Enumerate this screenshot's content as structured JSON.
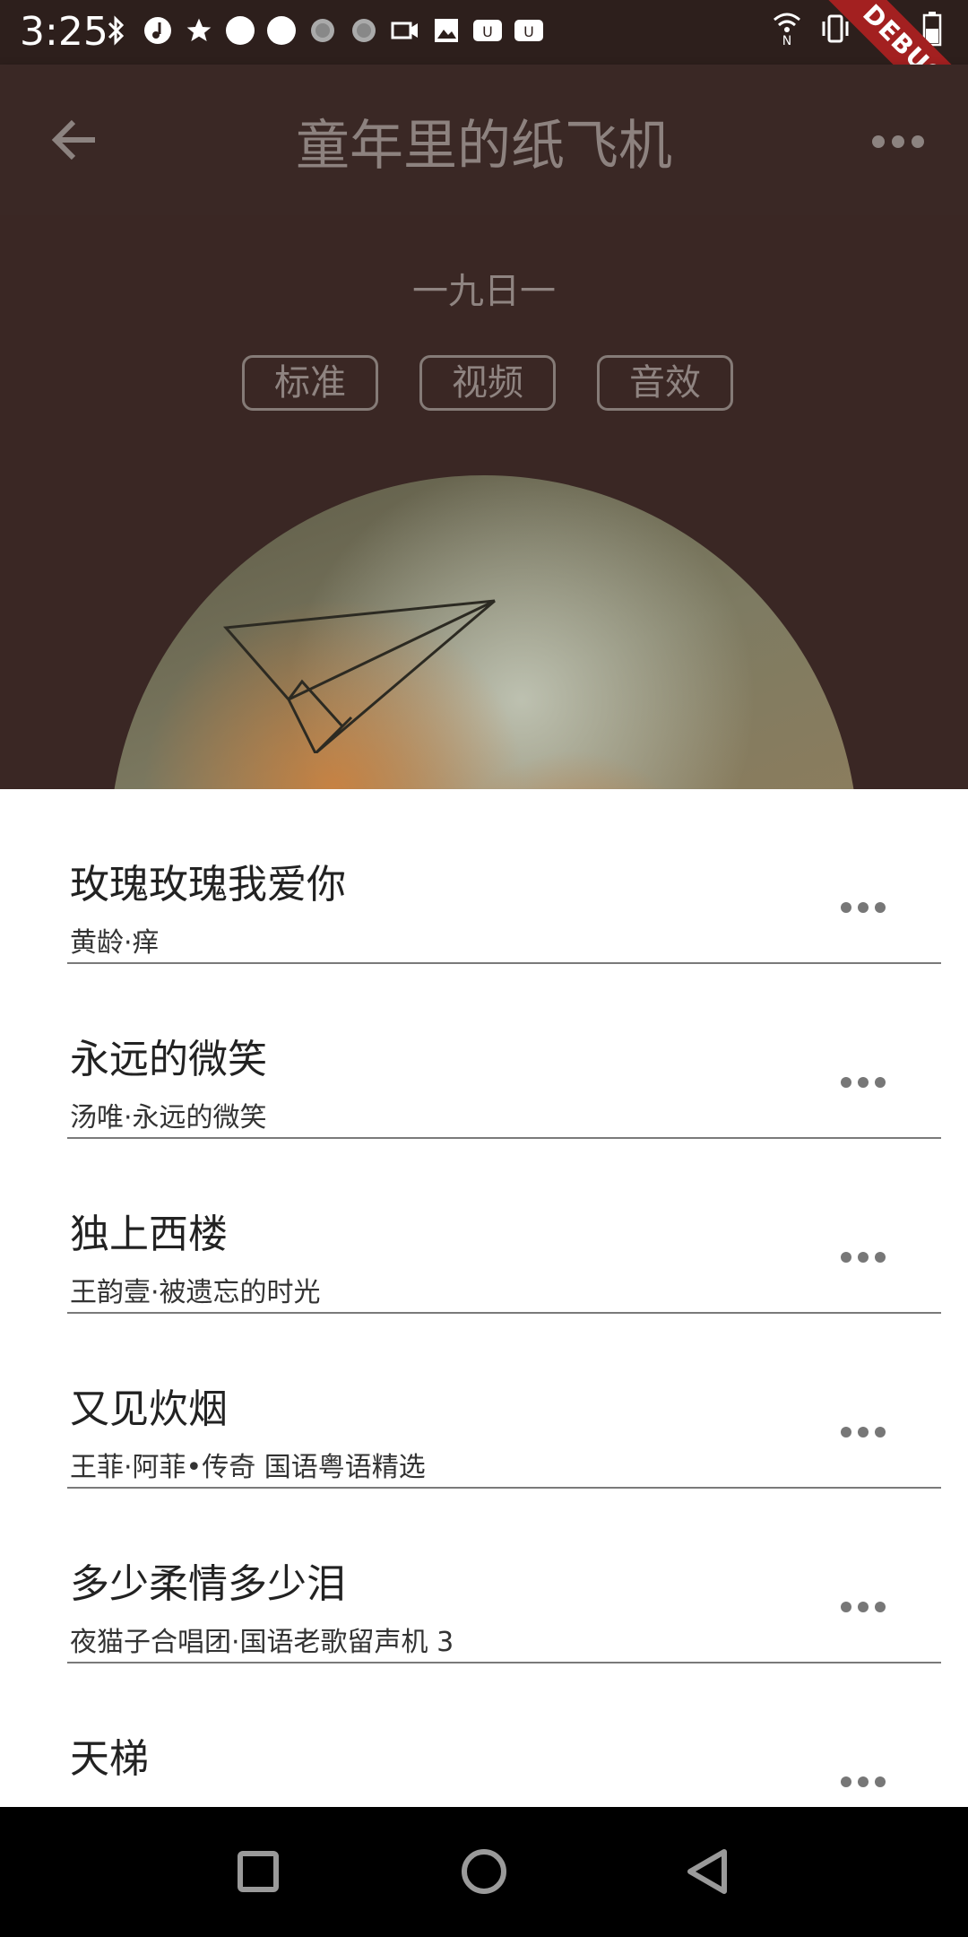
{
  "status": {
    "time": "3:25",
    "debug_label": "DEBUG"
  },
  "header": {
    "title": "童年里的纸飞机"
  },
  "album": {
    "artist": "一九日一",
    "chips": [
      "标准",
      "视频",
      "音效"
    ]
  },
  "songs": [
    {
      "title": "玫瑰玫瑰我爱你",
      "subtitle": "黄龄·痒"
    },
    {
      "title": "永远的微笑",
      "subtitle": "汤唯·永远的微笑"
    },
    {
      "title": "独上西楼",
      "subtitle": "王韵壹·被遗忘的时光"
    },
    {
      "title": "又见炊烟",
      "subtitle": "王菲·阿菲•传奇 国语粤语精选"
    },
    {
      "title": "多少柔情多少泪",
      "subtitle": "夜猫子合唱团·国语老歌留声机 3"
    },
    {
      "title": "天梯",
      "subtitle": ""
    }
  ],
  "colors": {
    "header_bg": "#3a2825",
    "album_bg": "#3a2724",
    "debug_ribbon": "#a32020"
  },
  "icons": {
    "back": "arrow-left-icon",
    "more": "more-horizontal-icon",
    "nav_recents": "square-icon",
    "nav_home": "circle-icon",
    "nav_back": "triangle-back-icon"
  }
}
